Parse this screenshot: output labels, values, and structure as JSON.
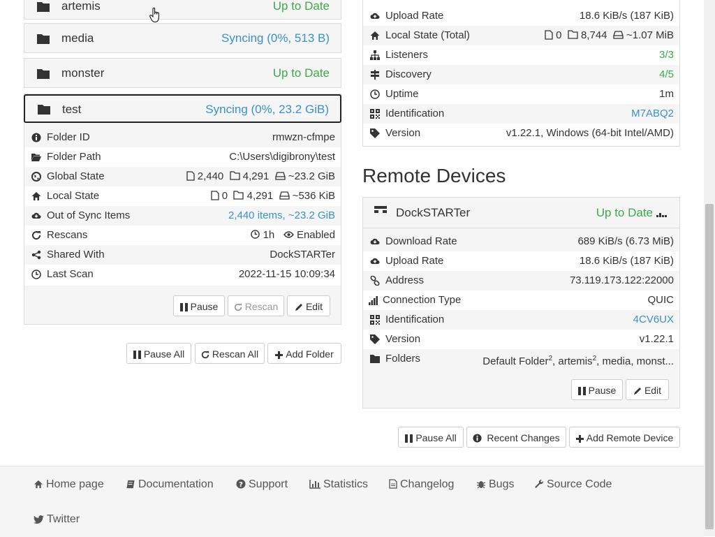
{
  "folders": [
    {
      "name": "artemis",
      "status": "Up to Date"
    },
    {
      "name": "media",
      "status": "Syncing (0%, 513 B)"
    },
    {
      "name": "monster",
      "status": "Up to Date"
    },
    {
      "name": "test",
      "status": "Syncing (0%, 23.2 GiB)"
    }
  ],
  "test_folder": {
    "folder_id": {
      "label": "Folder ID",
      "value": "rmwzn-cfmpe"
    },
    "folder_path": {
      "label": "Folder Path",
      "value": "C:\\Users\\digibrony\\test"
    },
    "global_state": {
      "label": "Global State",
      "files": "2,440",
      "dirs": "4,291",
      "size": "~23.2 GiB"
    },
    "local_state": {
      "label": "Local State",
      "files": "0",
      "dirs": "4,291",
      "size": "~536 KiB"
    },
    "out_of_sync": {
      "label": "Out of Sync Items",
      "value": "2,440 items, ~23.2 GiB"
    },
    "rescans": {
      "label": "Rescans",
      "interval": "1h",
      "watch": "Enabled"
    },
    "shared_with": {
      "label": "Shared With",
      "value": "DockSTARTer"
    },
    "last_scan": {
      "label": "Last Scan",
      "value": "2022-11-15 10:09:34"
    },
    "buttons": {
      "pause": "Pause",
      "rescan": "Rescan",
      "edit": "Edit"
    }
  },
  "folder_actions": {
    "pause_all": "Pause All",
    "rescan_all": "Rescan All",
    "add_folder": "Add Folder"
  },
  "this_device": {
    "upload_rate": {
      "label": "Upload Rate",
      "value": "18.6 KiB/s (187 KiB)"
    },
    "local_state_total": {
      "label": "Local State (Total)",
      "files": "0",
      "dirs": "8,744",
      "size": "~1.07 MiB"
    },
    "listeners": {
      "label": "Listeners",
      "value": "3/3"
    },
    "discovery": {
      "label": "Discovery",
      "value": "4/5"
    },
    "uptime": {
      "label": "Uptime",
      "value": "1m"
    },
    "identification": {
      "label": "Identification",
      "value": "M7ABQ2"
    },
    "version": {
      "label": "Version",
      "value": "v1.22.1, Windows (64-bit Intel/AMD)"
    }
  },
  "remote_devices": {
    "heading": "Remote Devices",
    "device": {
      "name": "DockSTARTer",
      "status": "Up to Date",
      "download_rate": {
        "label": "Download Rate",
        "value": "689 KiB/s (6.73 MiB)"
      },
      "upload_rate": {
        "label": "Upload Rate",
        "value": "18.6 KiB/s (187 KiB)"
      },
      "address": {
        "label": "Address",
        "value": "73.119.173.122:22000"
      },
      "connection_type": {
        "label": "Connection Type",
        "value": "QUIC"
      },
      "identification": {
        "label": "Identification",
        "value": "4CV6UX"
      },
      "version": {
        "label": "Version",
        "value": "v1.22.1"
      },
      "folders": {
        "label": "Folders",
        "f1": "Default Folder",
        "f1_sup": "2",
        "f2": "artemis",
        "f2_sup": "2",
        "rest": ", media, monst..."
      },
      "buttons": {
        "pause": "Pause",
        "edit": "Edit"
      }
    },
    "actions": {
      "pause_all": "Pause All",
      "recent_changes": "Recent Changes",
      "add_remote": "Add Remote Device"
    }
  },
  "footer": {
    "home": "Home page",
    "docs": "Documentation",
    "support": "Support",
    "stats": "Statistics",
    "changelog": "Changelog",
    "bugs": "Bugs",
    "source": "Source Code",
    "twitter": "Twitter"
  },
  "colors": {
    "green": "#3fa749",
    "blue": "#3b90c5"
  }
}
